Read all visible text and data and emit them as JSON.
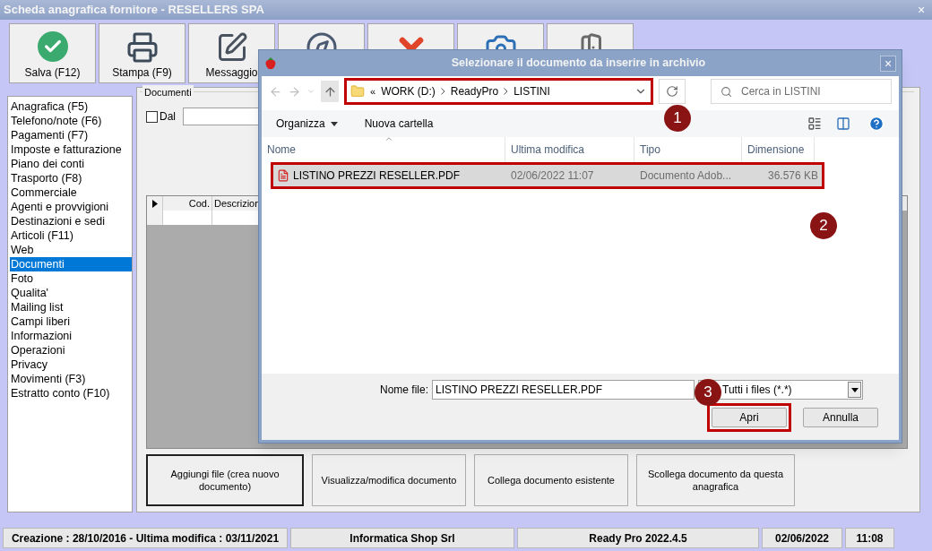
{
  "window": {
    "title": "Scheda anagrafica fornitore - RESELLERS SPA",
    "close": "×"
  },
  "toolbar": [
    {
      "kind": "save",
      "label": "Salva (F12)"
    },
    {
      "kind": "print",
      "label": "Stampa (F9)"
    },
    {
      "kind": "message",
      "label": "Messaggio"
    },
    {
      "kind": "compass"
    },
    {
      "kind": "delete"
    },
    {
      "kind": "camera"
    },
    {
      "kind": "exit"
    }
  ],
  "sidebar": {
    "items": [
      {
        "label": "Anagrafica (F5)",
        "selected": false
      },
      {
        "label": "Telefono/note (F6)",
        "selected": false
      },
      {
        "label": "Pagamenti (F7)",
        "selected": false
      },
      {
        "label": "Imposte e fatturazione",
        "selected": false
      },
      {
        "label": "Piano dei conti",
        "selected": false
      },
      {
        "label": "Trasporto (F8)",
        "selected": false
      },
      {
        "label": "Commerciale",
        "selected": false
      },
      {
        "label": "Agenti e provvigioni",
        "selected": false
      },
      {
        "label": "Destinazioni e sedi",
        "selected": false
      },
      {
        "label": "Articoli (F11)",
        "selected": false
      },
      {
        "label": "Web",
        "selected": false
      },
      {
        "label": "Documenti",
        "selected": true
      },
      {
        "label": "Foto",
        "selected": false
      },
      {
        "label": "Qualita'",
        "selected": false
      },
      {
        "label": "Mailing list",
        "selected": false
      },
      {
        "label": "Campi liberi",
        "selected": false
      },
      {
        "label": "Informazioni",
        "selected": false
      },
      {
        "label": "Operazioni",
        "selected": false
      },
      {
        "label": "Privacy",
        "selected": false
      },
      {
        "label": "Movimenti (F3)",
        "selected": false
      },
      {
        "label": "Estratto conto (F10)",
        "selected": false
      }
    ]
  },
  "documents": {
    "title": "Documenti",
    "dal": {
      "label": "Dal",
      "checked": false
    },
    "grid": {
      "columns": [
        "Cod.",
        "Descrizion"
      ]
    },
    "buttons": [
      {
        "label": "Aggiungi file (crea nuovo documento)",
        "default": true
      },
      {
        "label": "Visualizza/modifica documento",
        "default": false
      },
      {
        "label": "Collega documento esistente",
        "default": false
      },
      {
        "label": "Scollega documento da questa anagrafica",
        "default": false
      }
    ]
  },
  "dialog": {
    "title": "Selezionare il documento da inserire in archivio",
    "close": "×",
    "path_prefix": "«",
    "path": [
      "WORK (D:)",
      "ReadyPro",
      "LISTINI"
    ],
    "search": {
      "placeholder": "Cerca in LISTINI"
    },
    "commands": [
      {
        "label": "Organizza",
        "dropdown": true
      },
      {
        "label": "Nuova cartella",
        "dropdown": false
      }
    ],
    "columns": [
      "Nome",
      "Ultima modifica",
      "Tipo",
      "Dimensione"
    ],
    "files": [
      {
        "name": "LISTINO PREZZI RESELLER.PDF",
        "modified": "02/06/2022 11:07",
        "type": "Documento Adob...",
        "size": "36.576 KB",
        "selected": true
      }
    ],
    "filename": {
      "label": "Nome file:",
      "value": "LISTINO PREZZI RESELLER.PDF"
    },
    "filter": "Tutti i files (*.*)",
    "buttons": [
      {
        "label": "Apri",
        "highlighted": true
      },
      {
        "label": "Annulla",
        "highlighted": false
      }
    ],
    "callouts": [
      "1",
      "2",
      "3"
    ]
  },
  "status_bar": [
    "Creazione : 28/10/2016 - Ultima modifica : 03/11/2021",
    "Informatica Shop Srl",
    "Ready Pro 2022.4.5",
    "02/06/2022",
    "11:08"
  ]
}
